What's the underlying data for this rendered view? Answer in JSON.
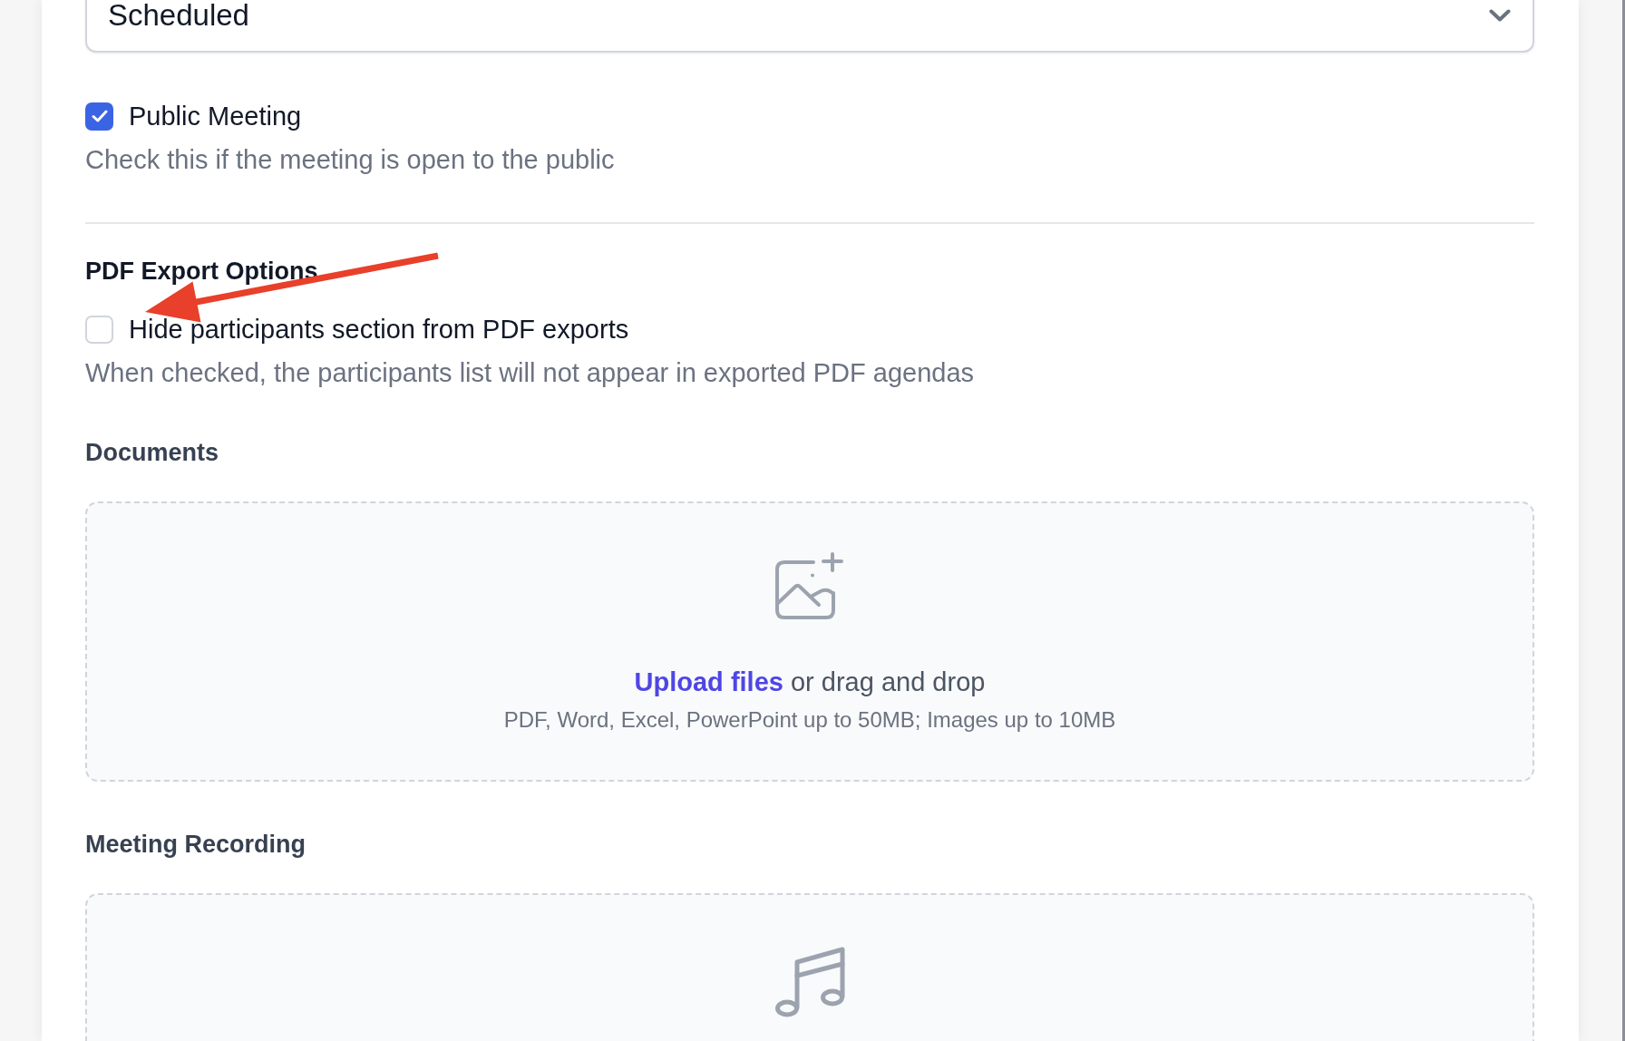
{
  "status_select": {
    "value": "Scheduled"
  },
  "public_meeting": {
    "label": "Public Meeting",
    "checked": true,
    "description": "Check this if the meeting is open to the public"
  },
  "pdf_export_options": {
    "heading": "PDF Export Options",
    "hide_participants": {
      "label": "Hide participants section from PDF exports",
      "checked": false,
      "description": "When checked, the participants list will not appear in exported PDF agendas"
    }
  },
  "uploads": [
    {
      "kind": "files",
      "heading": "Documents",
      "link": "Upload files",
      "prompt": "or drag and drop",
      "hint": "PDF, Word, Excel, PowerPoint up to 50MB; Images up to 10MB"
    },
    {
      "kind": "audio",
      "heading": "Meeting Recording"
    }
  ]
}
